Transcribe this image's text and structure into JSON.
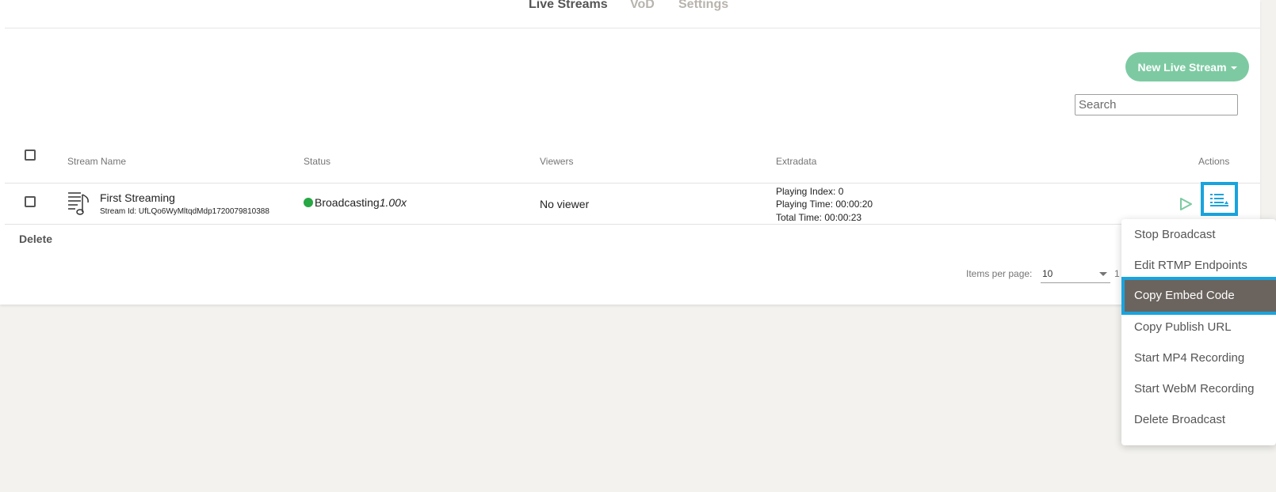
{
  "nav": {
    "tabs": [
      {
        "label": "Live Streams",
        "active": true
      },
      {
        "label": "VoD",
        "active": false
      },
      {
        "label": "Settings",
        "active": false
      }
    ]
  },
  "toolbar": {
    "new_stream_label": "New Live Stream",
    "search_placeholder": "Search"
  },
  "table": {
    "headers": [
      "Stream Name",
      "Status",
      "Viewers",
      "Extradata",
      "Actions"
    ],
    "rows": [
      {
        "name": "First Streaming",
        "stream_id": "Stream Id: UfLQo6WyMltqdMdp1720079810388",
        "status": "Broadcasting",
        "speed": "1.00x",
        "viewers": "No viewer",
        "extradata": [
          "Playing Index: 0",
          "Playing Time: 00:00:20",
          "Total Time: 00:00:23"
        ]
      }
    ],
    "delete_label": "Delete"
  },
  "pagination": {
    "items_per_page_label": "Items per page:",
    "items_per_page": "10",
    "range": "1"
  },
  "actions_menu": {
    "items": [
      {
        "label": "Stop Broadcast",
        "selected": false
      },
      {
        "label": "Edit RTMP Endpoints",
        "selected": false
      },
      {
        "label": "Copy Embed Code",
        "selected": true
      },
      {
        "label": "Copy Publish URL",
        "selected": false
      },
      {
        "label": "Start MP4 Recording",
        "selected": false
      },
      {
        "label": "Start WebM Recording",
        "selected": false
      },
      {
        "label": "Delete Broadcast",
        "selected": false
      }
    ]
  },
  "colors": {
    "accent_green": "#7dcaa2",
    "status_green": "#28a745",
    "highlight_blue": "#1aa3dd",
    "selected_item_bg": "#6b645e",
    "page_bg": "#f3f2ef"
  }
}
